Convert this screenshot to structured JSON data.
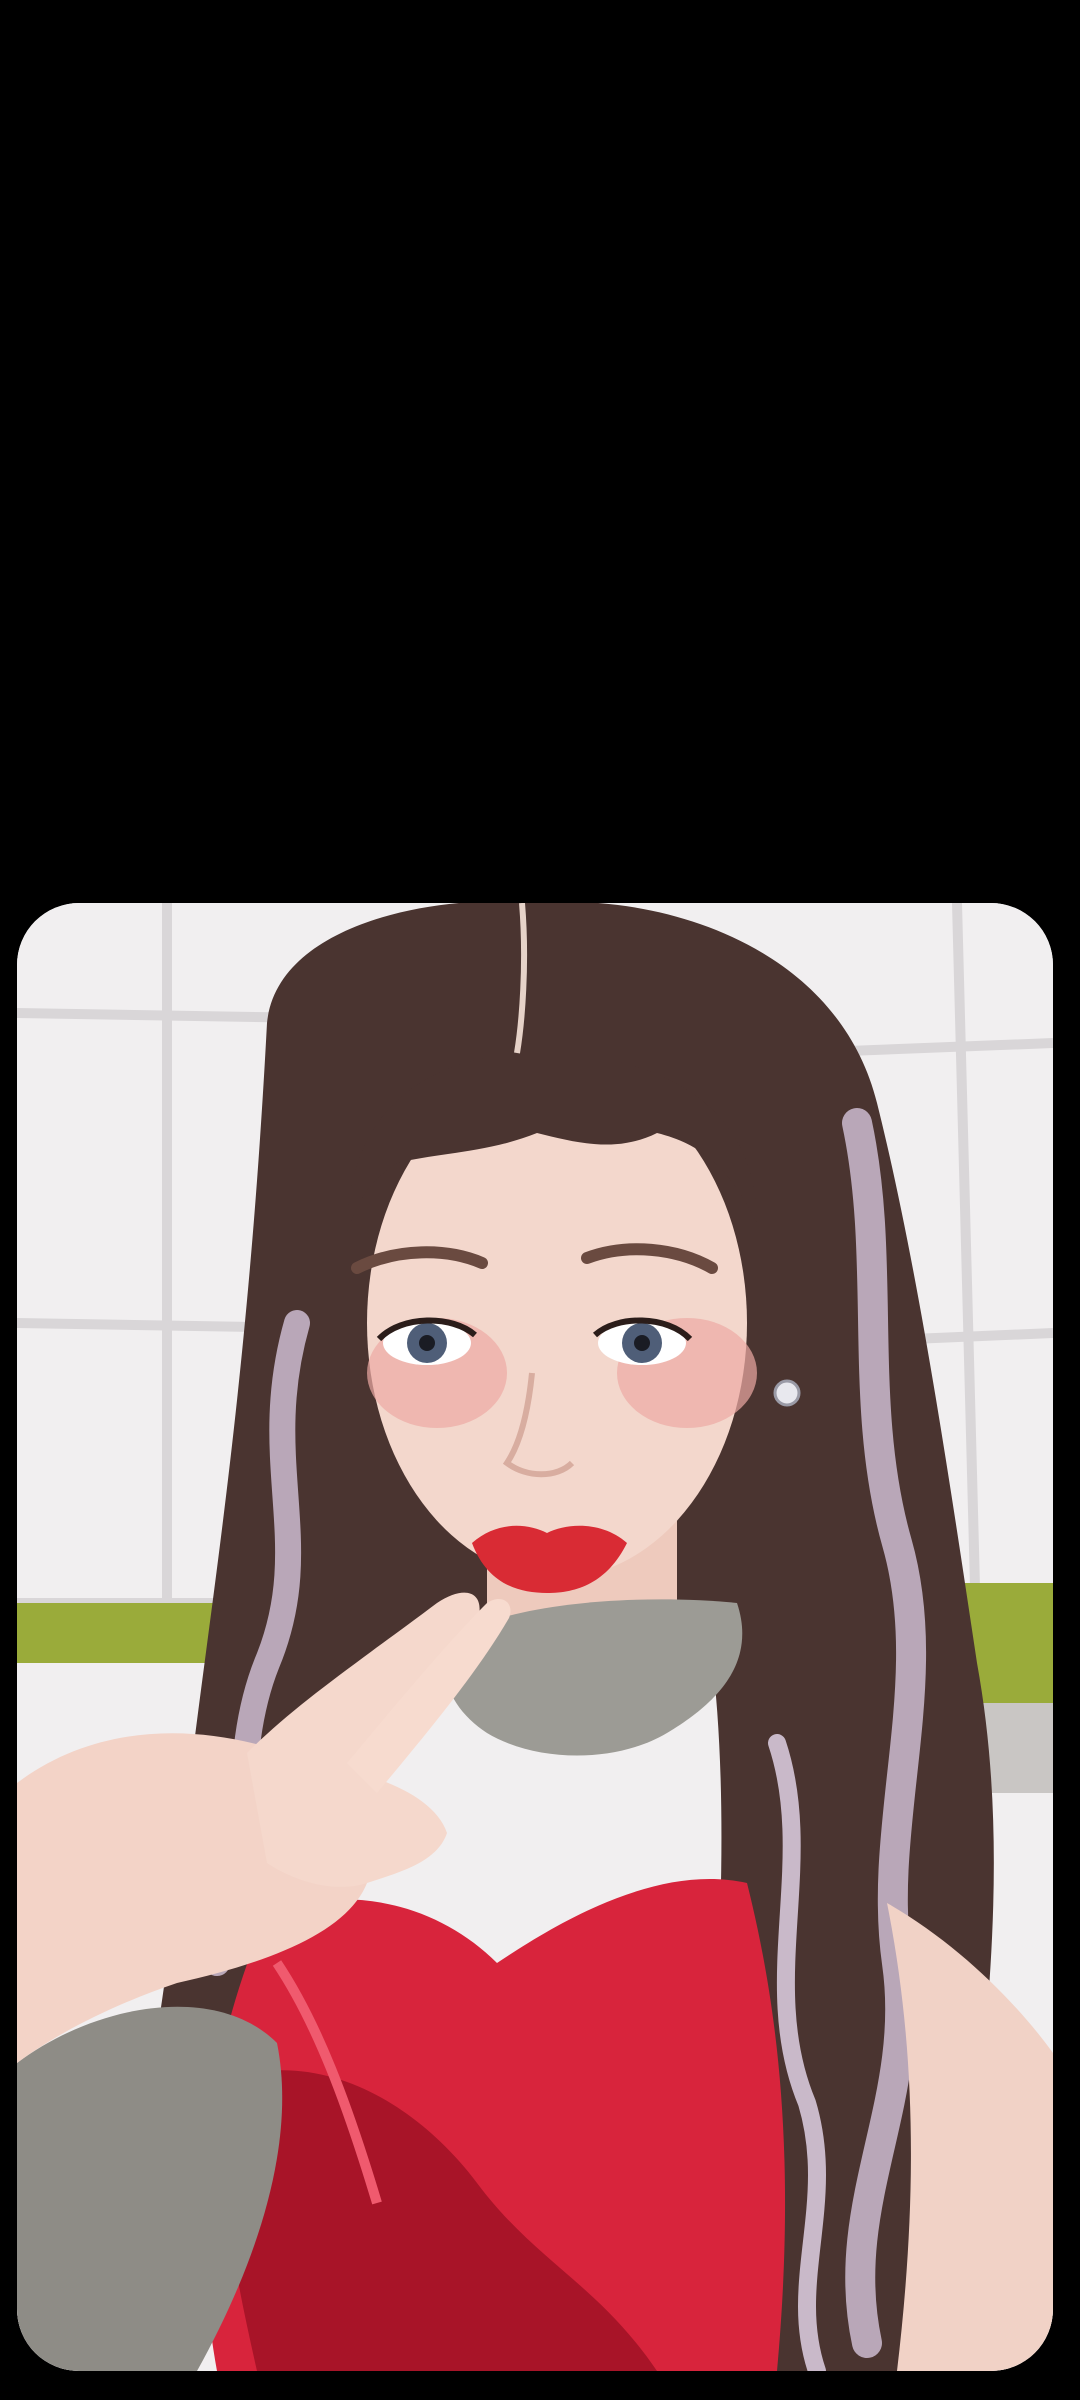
{
  "screen": {
    "background_color": "#000000"
  },
  "photo": {
    "subject": "portrait-photo",
    "colors": {
      "wall": "#f1eff0",
      "wall_grid": "#d9d6d8",
      "bench": "#9aab3a",
      "hair": "#4a3430",
      "hair_highlight": "#b9a7b8",
      "skin": "#f3d7cc",
      "cheek": "#eca9a4",
      "lips": "#d92b34",
      "fur": "#9c9b95",
      "dress": "#d8243c",
      "dress_shadow": "#a81428"
    }
  }
}
